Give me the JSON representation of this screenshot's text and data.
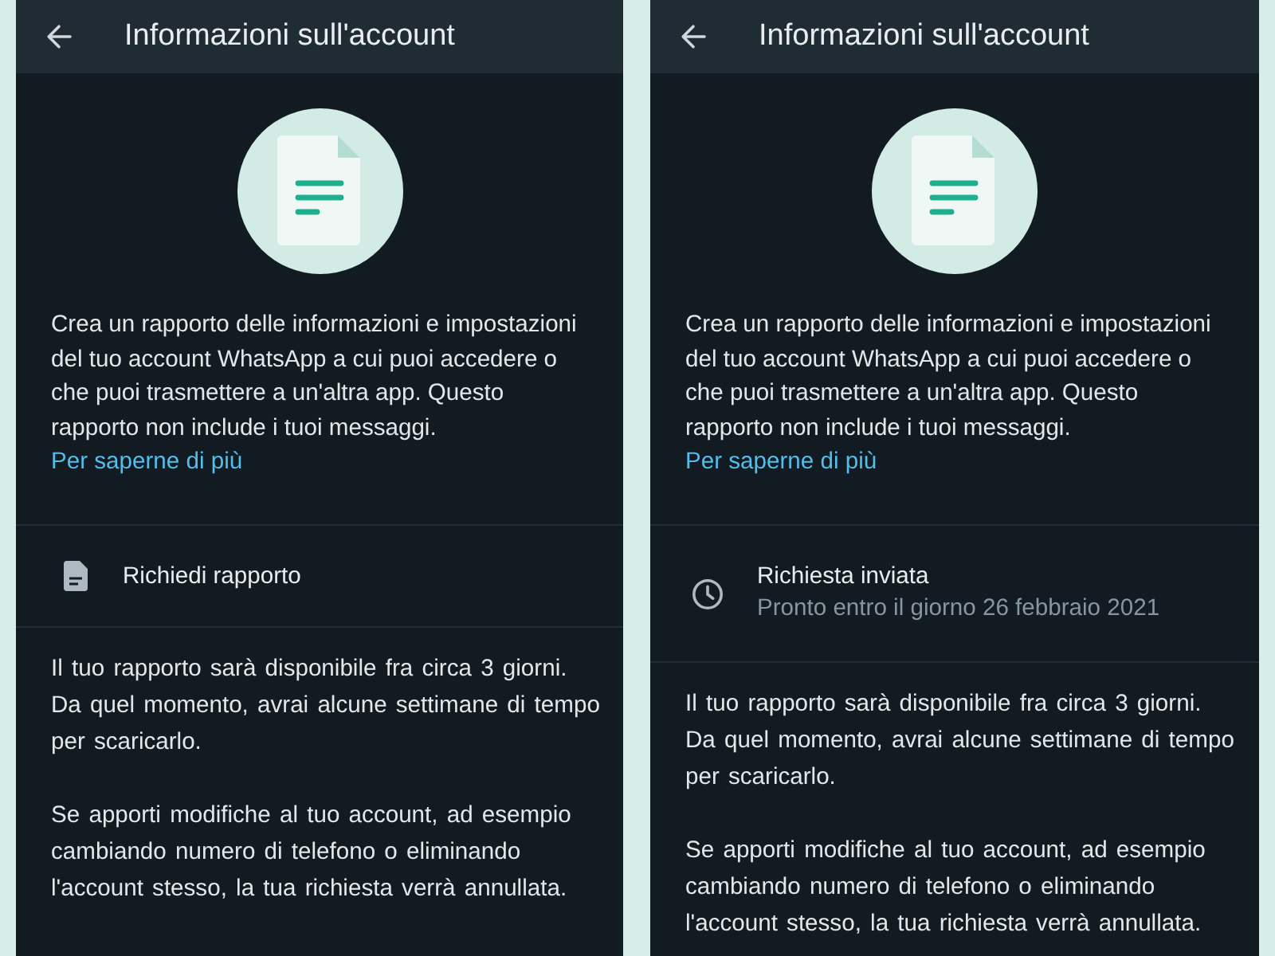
{
  "screens": [
    {
      "header": {
        "title": "Informazioni sull'account"
      },
      "intro": {
        "text": "Crea un rapporto delle informazioni e impostazioni del tuo account WhatsApp a cui puoi accedere o che puoi trasmettere a un'altra app. Questo rapporto non include i tuoi messaggi.",
        "link": "Per saperne di più"
      },
      "report": {
        "kind": "request",
        "title": "Richiedi rapporto"
      },
      "notes": [
        "Il tuo rapporto sarà disponibile fra circa 3 giorni. Da quel momento, avrai alcune settimane di tempo per scaricarlo.",
        "Se apporti modifiche al tuo account, ad esempio cambiando numero di telefono o eliminando l'account stesso, la tua richiesta verrà annullata."
      ]
    },
    {
      "header": {
        "title": "Informazioni sull'account"
      },
      "intro": {
        "text": "Crea un rapporto delle informazioni e impostazioni del tuo account WhatsApp a cui puoi accedere o che puoi trasmettere a un'altra app. Questo rapporto non include i tuoi messaggi.",
        "link": "Per saperne di più"
      },
      "report": {
        "kind": "pending",
        "title": "Richiesta inviata",
        "subtitle": "Pronto entro il giorno 26 febbraio 2021"
      },
      "notes": [
        "Il tuo rapporto sarà disponibile fra circa 3 giorni. Da quel momento, avrai alcune settimane di tempo per scaricarlo.",
        "Se apporti modifiche al tuo account, ad esempio cambiando numero di telefono o eliminando l'account stesso, la tua richiesta verrà annullata."
      ]
    }
  ]
}
